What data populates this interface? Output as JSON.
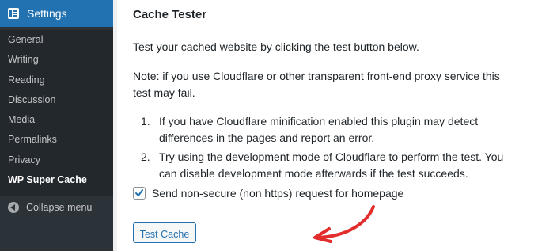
{
  "sidebar": {
    "header": {
      "label": "Settings",
      "icon": "settings-icon"
    },
    "items": [
      {
        "label": "General"
      },
      {
        "label": "Writing"
      },
      {
        "label": "Reading"
      },
      {
        "label": "Discussion"
      },
      {
        "label": "Media"
      },
      {
        "label": "Permalinks"
      },
      {
        "label": "Privacy"
      },
      {
        "label": "WP Super Cache",
        "current": true
      }
    ],
    "collapse_label": "Collapse menu"
  },
  "content": {
    "title": "Cache Tester",
    "intro": "Test your cached website by clicking the test button below.",
    "note_line1": "Note: if you use Cloudflare or other transparent front-end proxy service this",
    "note_line2": "test may fail.",
    "steps": [
      {
        "num": "1.",
        "line1": "If you have Cloudflare minification enabled this plugin may detect",
        "line2": "differences in the pages and report an error."
      },
      {
        "num": "2.",
        "line1": "Try using the development mode of Cloudflare to perform the test. You",
        "line2": "can disable development mode afterwards if the test succeeds."
      }
    ],
    "checkbox": {
      "label": "Send non-secure (non https) request for homepage",
      "checked": true
    },
    "button_label": "Test Cache"
  },
  "colors": {
    "sidebar_bg": "#2c3338",
    "accent": "#2271b1",
    "arrow": "#e32d2d"
  }
}
